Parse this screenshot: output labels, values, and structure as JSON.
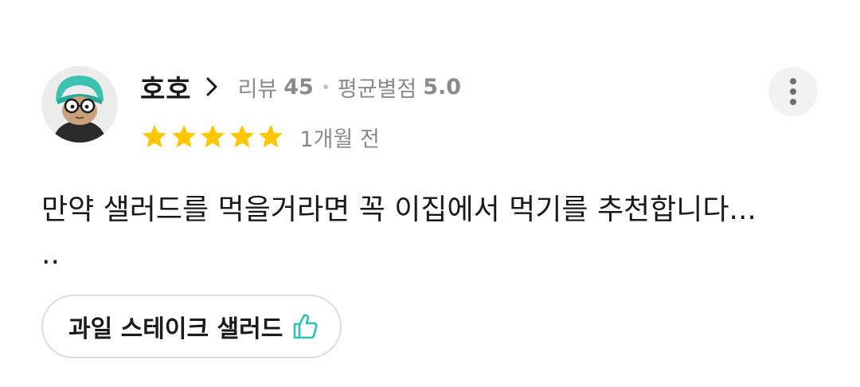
{
  "reviewer": {
    "name": "호호",
    "review_label": "리뷰",
    "review_count": "45",
    "avg_label": "평균별점",
    "avg_rating": "5.0"
  },
  "rating": {
    "stars": 5,
    "max": 5,
    "date": "1개월 전"
  },
  "review": {
    "text": "만약 샐러드를 먹을거라면 꼭 이집에서 먹기를 추천합니다...\n.."
  },
  "menu_tag": {
    "label": "과일 스테이크 샐러드",
    "icon": "thumbs-up-icon"
  },
  "colors": {
    "star": "#FFC700",
    "accent": "#2CC1B5",
    "muted_text": "#8a8a8a",
    "more_bg": "#f2f2f2"
  },
  "icons": {
    "more": "more-vertical-icon",
    "chevron": "chevron-right-icon"
  }
}
